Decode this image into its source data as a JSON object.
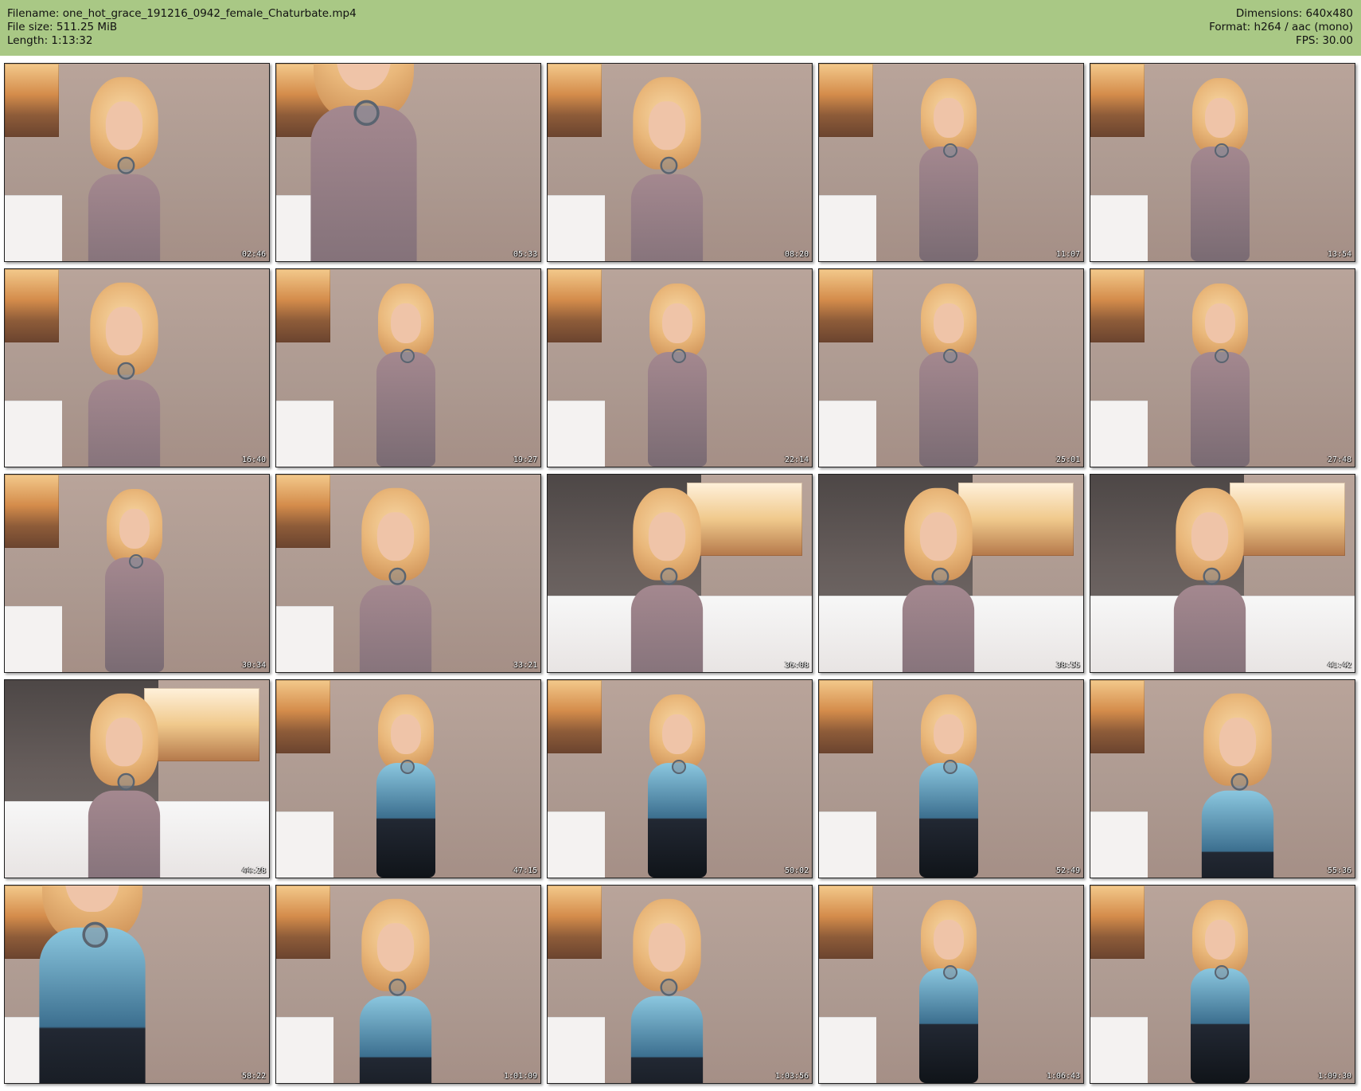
{
  "header": {
    "filename": "Filename: one_hot_grace_191216_0942_female_Chaturbate.mp4",
    "filesize": "File size: 511.25 MiB",
    "length": "Length: 1:13:32",
    "dimensions": "Dimensions: 640x480",
    "format": "Format: h264 / aac (mono)",
    "fps": "FPS: 30.00"
  },
  "thumbnails": [
    {
      "time": "02:46"
    },
    {
      "time": "05:33"
    },
    {
      "time": "08:20"
    },
    {
      "time": "11:07"
    },
    {
      "time": "13:54"
    },
    {
      "time": "16:40"
    },
    {
      "time": "19:27"
    },
    {
      "time": "22:14"
    },
    {
      "time": "25:01"
    },
    {
      "time": "27:48"
    },
    {
      "time": "30:34"
    },
    {
      "time": "33:21"
    },
    {
      "time": "36:08"
    },
    {
      "time": "38:55"
    },
    {
      "time": "41:42"
    },
    {
      "time": "44:28"
    },
    {
      "time": "47:15"
    },
    {
      "time": "50:02"
    },
    {
      "time": "52:49"
    },
    {
      "time": "55:36"
    },
    {
      "time": "58:22"
    },
    {
      "time": "1:01:09"
    },
    {
      "time": "1:03:56"
    },
    {
      "time": "1:06:43"
    },
    {
      "time": "1:09:30"
    }
  ],
  "colors": {
    "header_bg": "#a9c885",
    "thumbnail_border": "#1f1f1f",
    "timestamp_text": "#ffffff"
  }
}
